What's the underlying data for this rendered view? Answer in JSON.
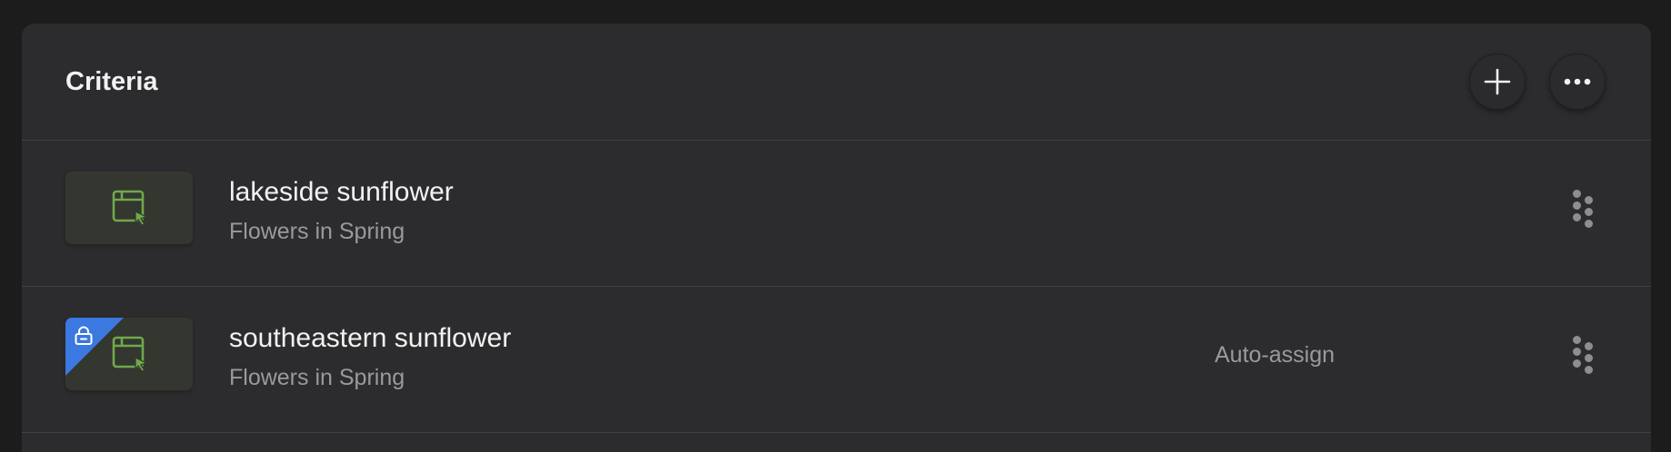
{
  "panel": {
    "title": "Criteria",
    "add_button": {
      "icon": "plus-icon"
    },
    "more_button": {
      "icon": "ellipsis-icon"
    }
  },
  "items": [
    {
      "title": "lakeside sunflower",
      "subtitle": "Flowers in Spring",
      "status": "",
      "locked": false,
      "thumbnail_icon": "browser-cursor-icon"
    },
    {
      "title": "southeastern sunflower",
      "subtitle": "Flowers in Spring",
      "status": "Auto-assign",
      "locked": true,
      "thumbnail_icon": "browser-cursor-icon"
    }
  ],
  "colors": {
    "background": "#1c1c1d",
    "panel": "#2c2c2e",
    "accent_green": "#6fa94a",
    "lock_blue": "#3b78e0",
    "text_primary": "#f2f2f2",
    "text_secondary": "#9a9a9c"
  }
}
